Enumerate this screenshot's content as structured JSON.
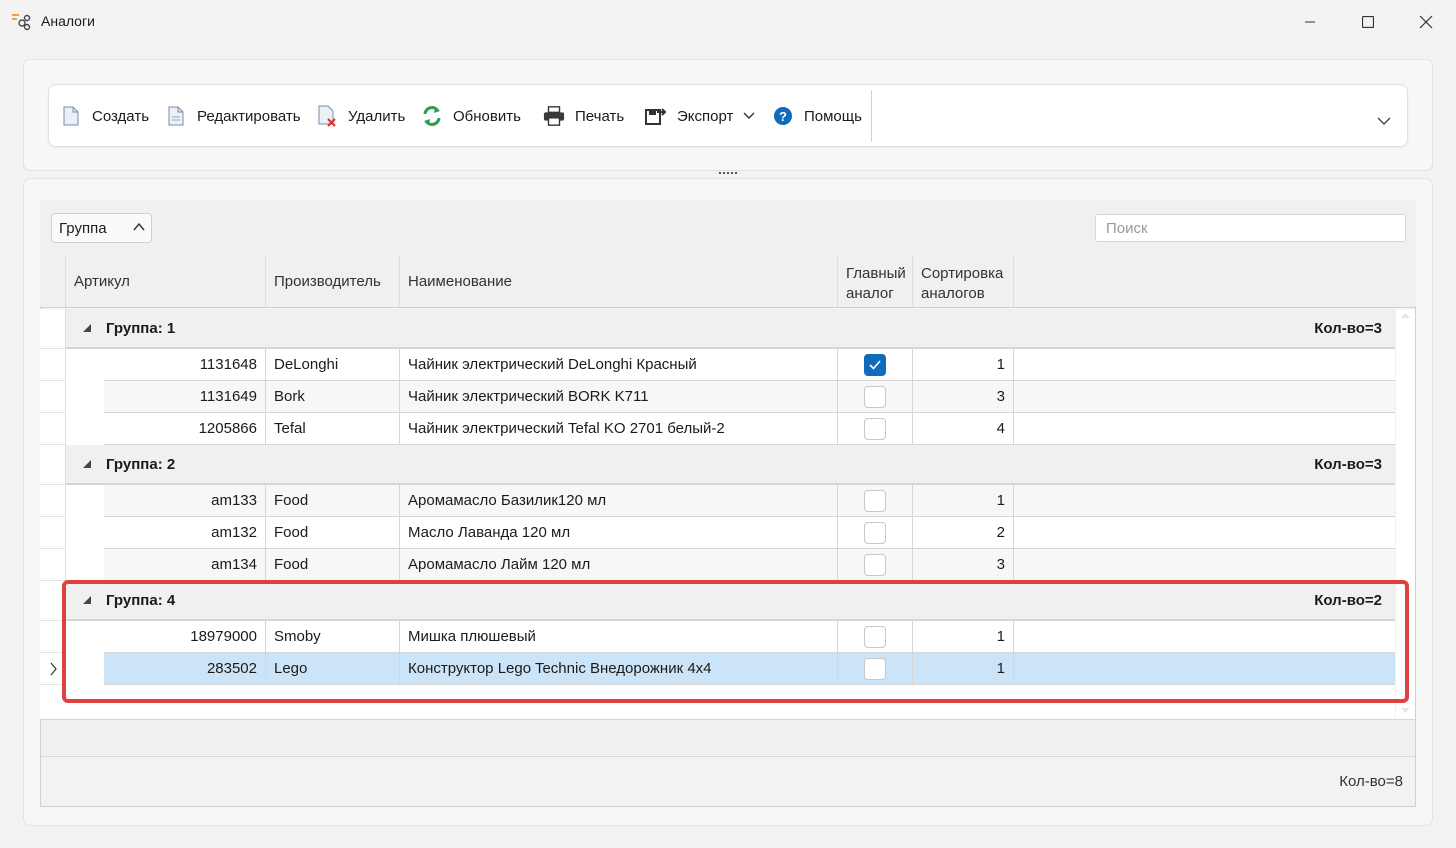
{
  "window": {
    "title": "Аналоги"
  },
  "toolbar": {
    "create": "Создать",
    "edit": "Редактировать",
    "delete": "Удалить",
    "refresh": "Обновить",
    "print": "Печать",
    "export": "Экспорт",
    "help": "Помощь"
  },
  "grouping": {
    "chip_label": "Группа"
  },
  "search": {
    "placeholder": "Поиск"
  },
  "columns": {
    "article": "Артикул",
    "manufacturer": "Производитель",
    "name": "Наименование",
    "main_analog_l1": "Главный",
    "main_analog_l2": "аналог",
    "sort_l1": "Сортировка",
    "sort_l2": "аналогов"
  },
  "groups": [
    {
      "label": "Группа: 1",
      "count": "Кол-во=3",
      "rows": [
        {
          "article": "1131648",
          "manufacturer": "DeLonghi",
          "name": "Чайник электрический DeLonghi Красный",
          "main": true,
          "sort": "1"
        },
        {
          "article": "1131649",
          "manufacturer": "Bork",
          "name": "Чайник электрический BORK K711",
          "main": false,
          "sort": "3"
        },
        {
          "article": "1205866",
          "manufacturer": "Tefal",
          "name": "Чайник электрический Tefal KO 2701 белый-2",
          "main": false,
          "sort": "4"
        }
      ]
    },
    {
      "label": "Группа: 2",
      "count": "Кол-во=3",
      "rows": [
        {
          "article": "am133",
          "manufacturer": "Food",
          "name": "Аромамасло Базилик120 мл",
          "main": false,
          "sort": "1"
        },
        {
          "article": "am132",
          "manufacturer": "Food",
          "name": "Масло Лаванда 120 мл",
          "main": false,
          "sort": "2"
        },
        {
          "article": "am134",
          "manufacturer": "Food",
          "name": "Аромамасло Лайм 120 мл",
          "main": false,
          "sort": "3"
        }
      ]
    },
    {
      "label": "Группа: 4",
      "count": "Кол-во=2",
      "rows": [
        {
          "article": "18979000",
          "manufacturer": "Smoby",
          "name": "Мишка плюшевый",
          "main": false,
          "sort": "1"
        },
        {
          "article": "283502",
          "manufacturer": "Lego",
          "name": "Конструктор Lego Technic Внедорожник 4x4",
          "main": false,
          "sort": "1"
        }
      ]
    }
  ],
  "footer": {
    "total": "Кол-во=8"
  },
  "colors": {
    "accent": "#0f6cbd",
    "selection": "#cce4f7",
    "highlight": "#e0403e"
  }
}
